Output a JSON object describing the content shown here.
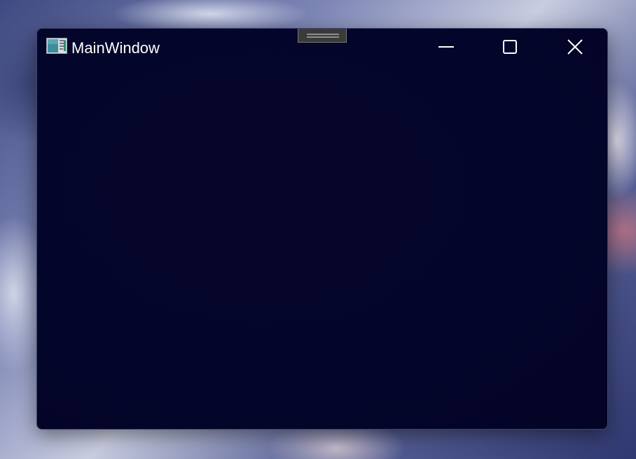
{
  "window": {
    "title": "MainWindow",
    "icon": "app-window-icon",
    "background_color": "#03052a"
  },
  "titlebar": {
    "drag_handle_icon": "drag-handle-icon",
    "buttons": [
      {
        "name": "minimize",
        "icon": "minimize-icon"
      },
      {
        "name": "maximize",
        "icon": "maximize-icon"
      },
      {
        "name": "close",
        "icon": "close-icon"
      }
    ]
  }
}
